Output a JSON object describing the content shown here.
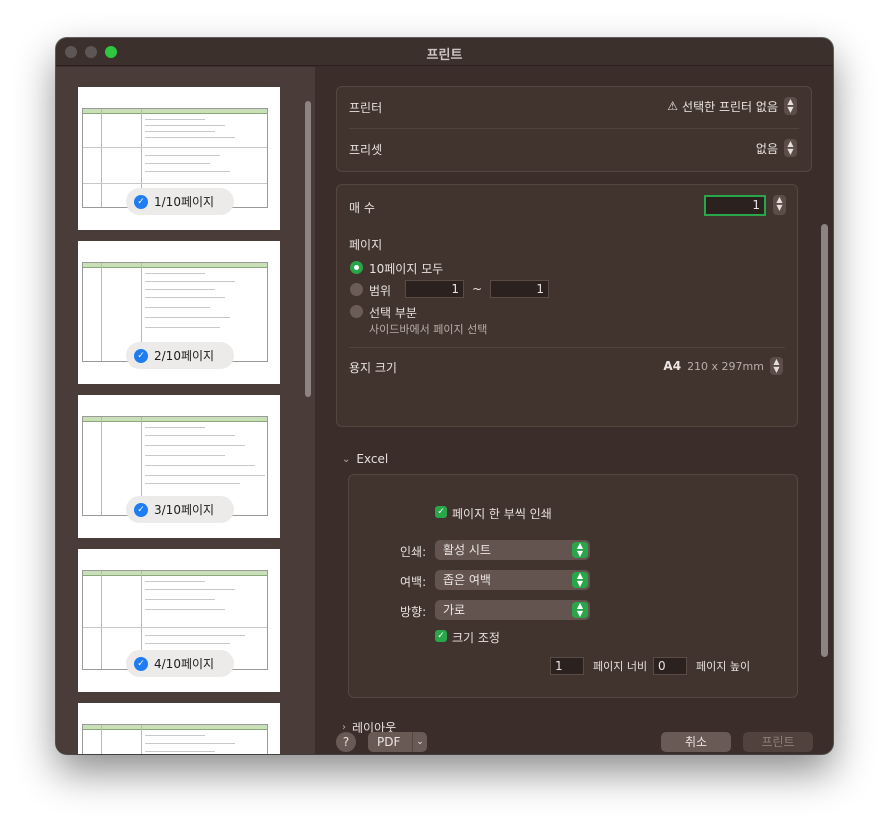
{
  "window": {
    "title": "프린트"
  },
  "sidebar": {
    "pages": [
      {
        "label": "1/10페이지"
      },
      {
        "label": "2/10페이지"
      },
      {
        "label": "3/10페이지"
      },
      {
        "label": "4/10페이지"
      }
    ]
  },
  "printer": {
    "label": "프린터",
    "value": "선택한 프린터 없음"
  },
  "preset": {
    "label": "프리셋",
    "value": "없음"
  },
  "copies": {
    "label": "매 수",
    "value": "1"
  },
  "pages_section": {
    "label": "페이지",
    "all_label": "10페이지 모두",
    "range_label": "범위",
    "range_from": "1",
    "range_sep": "~",
    "range_to": "1",
    "selection_label": "선택 부분",
    "selection_hint": "사이드바에서 페이지 선택"
  },
  "paper": {
    "label": "용지 크기",
    "value": "A4",
    "dims": "210 x 297mm"
  },
  "excel": {
    "title": "Excel",
    "one_copy_label": "페이지 한 부씩 인쇄",
    "print_label": "인쇄:",
    "print_value": "활성 시트",
    "margin_label": "여백:",
    "margin_value": "좁은 여백",
    "orientation_label": "방향:",
    "orientation_value": "가로",
    "scale_label": "크기 조정",
    "width_value": "1",
    "width_label": "페이지 너비",
    "height_value": "0",
    "height_label": "페이지 높이"
  },
  "layout": {
    "title": "레이아웃"
  },
  "footer": {
    "help": "?",
    "pdf": "PDF",
    "cancel": "취소",
    "print": "프린트"
  },
  "colors": {
    "accent": "#2aa64a",
    "selection_blue": "#1f7cf2",
    "window_bg": "#3a2d2a"
  },
  "icons": [
    "warning-icon",
    "checkmark-icon",
    "chevron-updown-icon",
    "chevron-down-icon",
    "chevron-right-icon",
    "help-icon"
  ]
}
